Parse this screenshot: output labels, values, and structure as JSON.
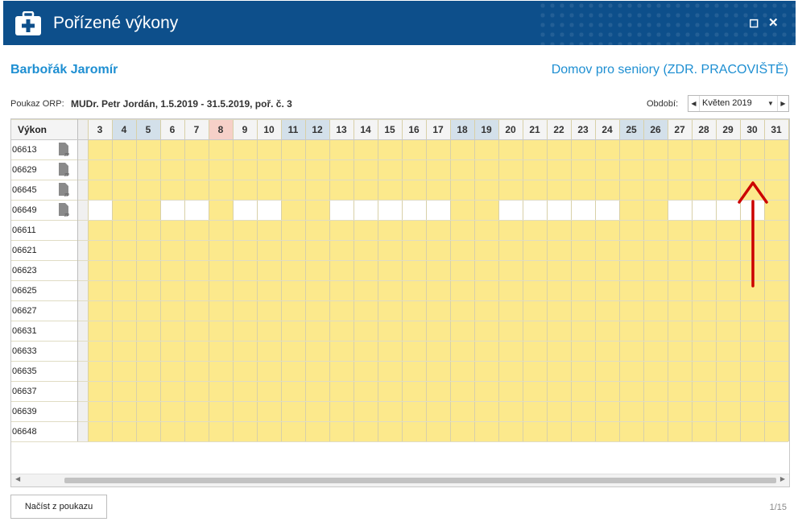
{
  "window": {
    "title": "Pořízené výkony",
    "maximize_glyph": "◻",
    "close_glyph": "✕"
  },
  "patient": {
    "name": "Barbořák Jaromír",
    "facility": "Domov pro seniory (ZDR. PRACOVIŠTĚ)"
  },
  "orp": {
    "label": "Poukaz ORP:",
    "value": "MUDr. Petr Jordán, 1.5.2019 - 31.5.2019, poř. č. 3"
  },
  "period": {
    "label": "Období:",
    "value": "Květen 2019"
  },
  "grid": {
    "header_label": "Výkon",
    "days": [
      3,
      4,
      5,
      6,
      7,
      8,
      9,
      10,
      11,
      12,
      13,
      14,
      15,
      16,
      17,
      18,
      19,
      20,
      21,
      22,
      23,
      24,
      25,
      26,
      27,
      28,
      29,
      30,
      31
    ],
    "weekend_days": [
      4,
      5,
      11,
      12,
      18,
      19,
      25,
      26
    ],
    "holiday_days": [
      8
    ],
    "rows": [
      {
        "code": "06613",
        "icon": "zp-document-icon",
        "filled": "all"
      },
      {
        "code": "06629",
        "icon": "zp-document-icon",
        "filled": "all"
      },
      {
        "code": "06645",
        "icon": "zp-document-icon",
        "filled": "all"
      },
      {
        "code": "06649",
        "icon": "zp-document-icon",
        "filled_days": [
          4,
          5,
          8,
          11,
          12,
          18,
          19,
          25,
          26,
          31
        ]
      },
      {
        "code": "06611",
        "filled": "all"
      },
      {
        "code": "06621",
        "filled": "all"
      },
      {
        "code": "06623",
        "filled": "all"
      },
      {
        "code": "06625",
        "filled": "all"
      },
      {
        "code": "06627",
        "filled": "all"
      },
      {
        "code": "06631",
        "filled": "all"
      },
      {
        "code": "06633",
        "filled": "all"
      },
      {
        "code": "06635",
        "filled": "all"
      },
      {
        "code": "06637",
        "filled": "all"
      },
      {
        "code": "06639",
        "filled": "all"
      },
      {
        "code": "06648",
        "filled": "all"
      }
    ],
    "zp_icon_text": "ZP"
  },
  "footer": {
    "load_button": "Načíst z poukazu",
    "pager": "1/15"
  },
  "colors": {
    "titlebar": "#0d4f8b",
    "accent": "#1e8fd2",
    "filled_cell": "#fce98c",
    "weekend_header": "#d3e0ea",
    "holiday_header": "#f6d0c8",
    "annotation_arrow": "#cc0000"
  }
}
